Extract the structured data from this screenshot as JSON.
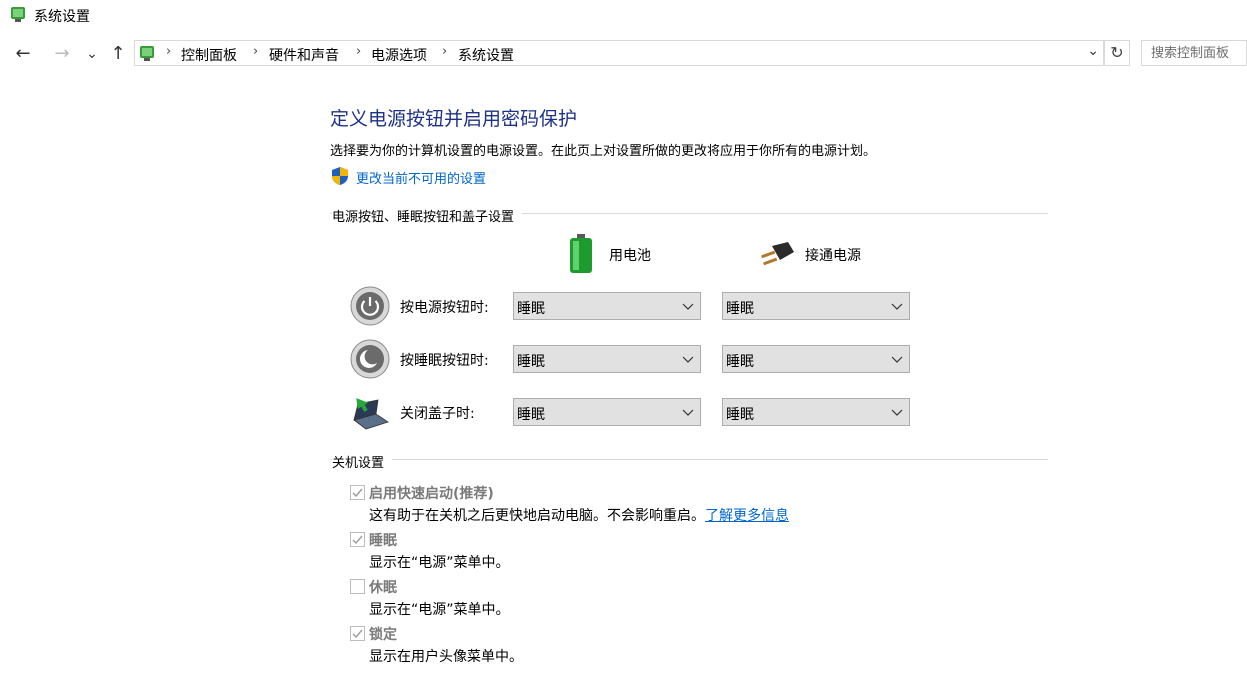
{
  "window": {
    "title": "系统设置"
  },
  "nav": {
    "back_glyph": "←",
    "forward_glyph": "→",
    "recent_glyph": "⌄",
    "up_glyph": "↑",
    "breadcrumb": [
      "控制面板",
      "硬件和声音",
      "电源选项",
      "系统设置"
    ],
    "breadcrumb_sep": "›",
    "refresh_glyph": "↻",
    "search_placeholder": "搜索控制面板"
  },
  "page": {
    "heading": "定义电源按钮并启用密码保护",
    "description": "选择要为你的计算机设置的电源设置。在此页上对设置所做的更改将应用于你所有的电源计划。",
    "change_link": "更改当前不可用的设置"
  },
  "power_buttons": {
    "group_title": "电源按钮、睡眠按钮和盖子设置",
    "columns": {
      "battery": "用电池",
      "plugged_in": "接通电源"
    },
    "rows": [
      {
        "label": "按电源按钮时:",
        "battery": "睡眠",
        "plugged_in": "睡眠",
        "icon": "power-icon"
      },
      {
        "label": "按睡眠按钮时:",
        "battery": "睡眠",
        "plugged_in": "睡眠",
        "icon": "sleep-icon"
      },
      {
        "label": "关闭盖子时:",
        "battery": "睡眠",
        "plugged_in": "睡眠",
        "icon": "lid-icon"
      }
    ]
  },
  "shutdown": {
    "group_title": "关机设置",
    "items": [
      {
        "label": "启用快速启动(推荐)",
        "checked": true,
        "desc": "这有助于在关机之后更快地启动电脑。不会影响重启。",
        "link": "了解更多信息"
      },
      {
        "label": "睡眠",
        "checked": true,
        "desc": "显示在“电源”菜单中。"
      },
      {
        "label": "休眠",
        "checked": false,
        "desc": "显示在“电源”菜单中。"
      },
      {
        "label": "锁定",
        "checked": true,
        "desc": "显示在用户头像菜单中。"
      }
    ]
  },
  "colors": {
    "heading": "#1e3287",
    "link": "#0066cc",
    "disabled_text": "#7a7a7a"
  }
}
